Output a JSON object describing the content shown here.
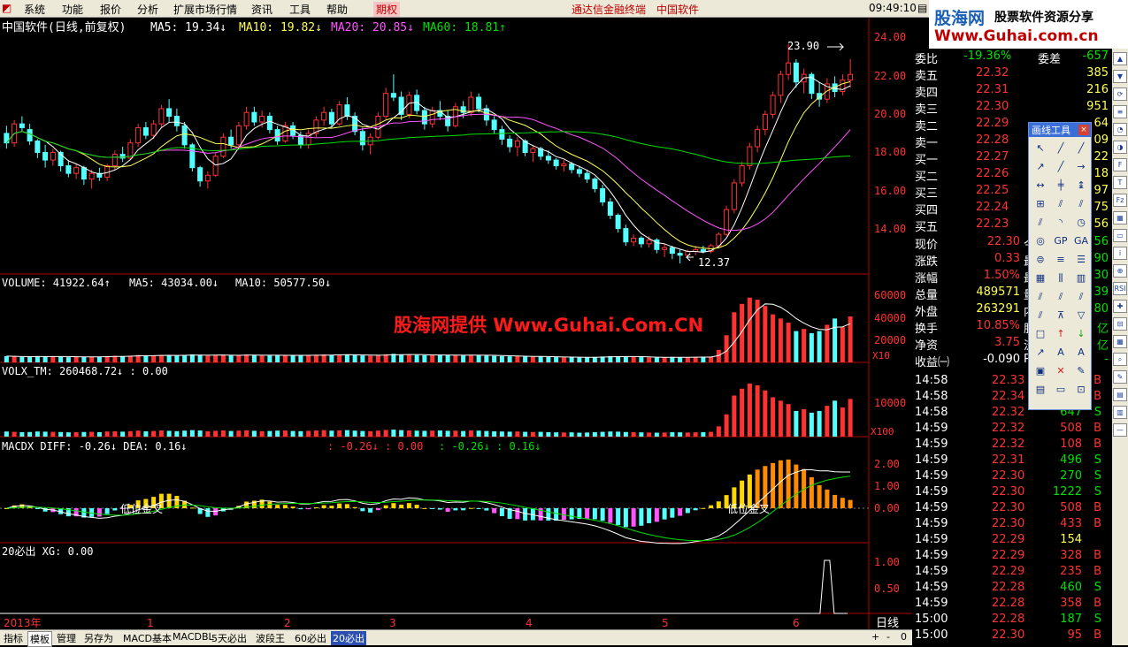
{
  "menu": {
    "items": [
      "系统",
      "功能",
      "报价",
      "分析",
      "扩展市场行情",
      "资讯",
      "工具",
      "帮助"
    ],
    "futures_tab": "期权",
    "ticker_text": "通达信金融终端",
    "stock_name": "中国软件",
    "clock": "09:49:10"
  },
  "logo": {
    "brand": "股海网",
    "tagline": "股票软件资源分享",
    "url": "Www.Guhai.com.cn"
  },
  "watermark": "股海网提供 Www.Guhai.Com.CN",
  "price_panel": {
    "title": "中国软件(日线,前复权)",
    "ma5": "MA5: 19.34↓",
    "ma10": "MA10: 19.82↓",
    "ma20": "MA20: 20.85↓",
    "ma60": "MA60: 18.81↑",
    "high_label": "23.90",
    "low_label": "12.37",
    "axis": [
      "24.00",
      "22.00",
      "20.00",
      "18.00",
      "16.00",
      "14.00"
    ]
  },
  "volume_panel": {
    "title": "VOLUME: 41922.64↑",
    "ma5": "MA5: 43034.00↓",
    "ma10": "MA10: 50577.50↓",
    "axis": [
      "60000",
      "40000",
      "20000"
    ],
    "unit": "X10"
  },
  "volx_panel": {
    "title": "VOLX_TM: 260468.72↓ : 0.00",
    "axis": [
      "10000"
    ],
    "unit": "X100"
  },
  "macd_panel": {
    "title": "MACDX DIFF: -0.26↓ DEA: 0.16↓",
    "extra1": ": -0.26↓ : 0.00",
    "extra2": ": -0.26↓ : 0.16↓",
    "golden_cross": "低位金叉",
    "axis": [
      "2.00",
      "1.00",
      "0.00"
    ]
  },
  "signal_panel": {
    "title": "20必出 XG: 0.00",
    "axis": [
      "1.00",
      "0.50"
    ]
  },
  "time_axis": [
    "2013年",
    "1",
    "2",
    "3",
    "4",
    "5",
    "6"
  ],
  "period_label": "日线",
  "quote": {
    "weibi": {
      "label": "委比",
      "value": "-19.36%",
      "label2": "委差",
      "value2": "-657"
    },
    "asks": [
      {
        "label": "卖五",
        "price": "22.32",
        "vol": "385"
      },
      {
        "label": "卖四",
        "price": "22.31",
        "vol": "216"
      },
      {
        "label": "卖三",
        "price": "22.30",
        "vol": "951"
      },
      {
        "label": "卖二",
        "price": "22.29",
        "vol": "64"
      },
      {
        "label": "卖一",
        "price": "22.28",
        "vol": "09"
      }
    ],
    "bids": [
      {
        "label": "买一",
        "price": "22.27",
        "vol": "22"
      },
      {
        "label": "买二",
        "price": "22.26",
        "vol": "18"
      },
      {
        "label": "买三",
        "price": "22.25",
        "vol": "97"
      },
      {
        "label": "买四",
        "price": "22.24",
        "vol": "75"
      },
      {
        "label": "买五",
        "price": "22.23",
        "vol": "56"
      }
    ],
    "stats": [
      {
        "label": "现价",
        "value": "22.30",
        "label2": "今",
        "value2": "56"
      },
      {
        "label": "涨跌",
        "value": "0.33",
        "label2": "最",
        "value2": "90"
      },
      {
        "label": "涨幅",
        "value": "1.50%",
        "label2": "最",
        "value2": "30"
      },
      {
        "label": "总量",
        "value": "489571",
        "label2": "量",
        "value2": "39"
      },
      {
        "label": "外盘",
        "value": "263291",
        "label2": "内",
        "value2": "80"
      },
      {
        "label": "换手",
        "value": "10.85%",
        "label2": "股",
        "value2": "亿"
      },
      {
        "label": "净资",
        "value": "3.75",
        "label2": "流",
        "value2": "亿"
      },
      {
        "label": "收益㈠",
        "value": "-0.090",
        "label2": "PE",
        "value2": "-"
      }
    ],
    "ticks": [
      {
        "time": "14:58",
        "price": "22.33",
        "vol": "",
        "side": "B"
      },
      {
        "time": "14:58",
        "price": "22.34",
        "vol": "",
        "side": "B"
      },
      {
        "time": "14:58",
        "price": "22.32",
        "vol": "647",
        "side": "S"
      },
      {
        "time": "14:59",
        "price": "22.32",
        "vol": "508",
        "side": "B"
      },
      {
        "time": "14:59",
        "price": "22.32",
        "vol": "108",
        "side": "B"
      },
      {
        "time": "14:59",
        "price": "22.31",
        "vol": "496",
        "side": "S"
      },
      {
        "time": "14:59",
        "price": "22.30",
        "vol": "270",
        "side": "S"
      },
      {
        "time": "14:59",
        "price": "22.30",
        "vol": "1222",
        "side": "S"
      },
      {
        "time": "14:59",
        "price": "22.30",
        "vol": "508",
        "side": "B"
      },
      {
        "time": "14:59",
        "price": "22.30",
        "vol": "433",
        "side": "B"
      },
      {
        "time": "14:59",
        "price": "22.29",
        "vol": "154",
        "side": ""
      },
      {
        "time": "14:59",
        "price": "22.29",
        "vol": "328",
        "side": "B"
      },
      {
        "time": "14:59",
        "price": "22.29",
        "vol": "235",
        "side": "B"
      },
      {
        "time": "14:59",
        "price": "22.28",
        "vol": "460",
        "side": "S"
      },
      {
        "time": "14:59",
        "price": "22.28",
        "vol": "358",
        "side": "B"
      },
      {
        "time": "15:00",
        "price": "22.28",
        "vol": "187",
        "side": "S"
      },
      {
        "time": "15:00",
        "price": "22.30",
        "vol": "95",
        "side": "B"
      }
    ]
  },
  "drawing_tools": {
    "title": "画线工具",
    "close": "×"
  },
  "bottom_tabs": [
    "指标",
    "模板",
    "管理",
    "另存为",
    "MACD基本",
    "MACDBL",
    "5天必出",
    "波段王",
    "60必出",
    "20必出"
  ],
  "bottom_right": [
    "+",
    "-",
    "0"
  ],
  "colors": {
    "up": "#ff3232",
    "down": "#54ffff",
    "ma5": "#ffffff",
    "ma10": "#ffff54",
    "ma20": "#ff54ff",
    "ma60": "#00e000",
    "grid": "#b00000"
  },
  "chart_data": {
    "type": "candlestick",
    "candles": [
      [
        19.2,
        19.6,
        18.4,
        18.7
      ],
      [
        18.7,
        19.9,
        18.5,
        19.7
      ],
      [
        19.7,
        20.1,
        19.3,
        19.5
      ],
      [
        19.4,
        19.7,
        18.6,
        18.8
      ],
      [
        18.8,
        18.9,
        17.9,
        18.2
      ],
      [
        18.2,
        18.6,
        17.4,
        17.8
      ],
      [
        17.8,
        18.4,
        17.5,
        18.2
      ],
      [
        18.2,
        18.3,
        17.2,
        17.5
      ],
      [
        17.5,
        17.8,
        16.9,
        17.1
      ],
      [
        17.1,
        17.6,
        16.8,
        17.4
      ],
      [
        17.4,
        17.5,
        16.5,
        16.8
      ],
      [
        16.8,
        17.3,
        16.3,
        17.1
      ],
      [
        17.1,
        17.4,
        16.7,
        16.9
      ],
      [
        16.9,
        17.6,
        16.7,
        17.5
      ],
      [
        17.5,
        18.3,
        17.3,
        18.1
      ],
      [
        18.1,
        18.5,
        17.7,
        17.9
      ],
      [
        17.9,
        18.9,
        17.8,
        18.7
      ],
      [
        18.7,
        19.7,
        18.5,
        19.5
      ],
      [
        19.5,
        19.8,
        18.9,
        19.1
      ],
      [
        19.1,
        19.9,
        18.9,
        19.7
      ],
      [
        19.7,
        20.7,
        19.5,
        20.5
      ],
      [
        20.5,
        21.0,
        19.8,
        20.1
      ],
      [
        20.1,
        20.5,
        19.3,
        19.6
      ],
      [
        19.6,
        19.8,
        18.4,
        18.6
      ],
      [
        18.6,
        18.7,
        17.2,
        17.4
      ],
      [
        17.4,
        17.5,
        16.4,
        16.7
      ],
      [
        16.7,
        17.2,
        16.3,
        17.0
      ],
      [
        17.0,
        18.2,
        16.9,
        18.0
      ],
      [
        18.0,
        19.2,
        17.9,
        19.0
      ],
      [
        19.0,
        19.4,
        18.4,
        18.6
      ],
      [
        18.6,
        19.8,
        18.5,
        19.6
      ],
      [
        19.6,
        20.6,
        19.4,
        20.3
      ],
      [
        20.3,
        20.6,
        19.6,
        19.8
      ],
      [
        19.8,
        20.4,
        19.5,
        20.1
      ],
      [
        20.1,
        20.3,
        19.2,
        19.4
      ],
      [
        19.4,
        19.6,
        18.6,
        18.8
      ],
      [
        18.8,
        19.8,
        18.7,
        19.6
      ],
      [
        19.6,
        19.8,
        18.9,
        19.1
      ],
      [
        19.1,
        19.3,
        18.4,
        18.6
      ],
      [
        18.6,
        19.4,
        18.4,
        19.2
      ],
      [
        19.2,
        20.1,
        19.0,
        19.9
      ],
      [
        19.9,
        20.6,
        19.6,
        20.3
      ],
      [
        20.3,
        20.5,
        19.5,
        19.7
      ],
      [
        19.7,
        20.9,
        19.6,
        20.7
      ],
      [
        20.7,
        21.1,
        19.9,
        20.1
      ],
      [
        20.1,
        20.3,
        19.1,
        19.3
      ],
      [
        19.3,
        19.5,
        18.3,
        18.6
      ],
      [
        18.6,
        19.2,
        18.1,
        19.0
      ],
      [
        19.0,
        20.3,
        18.9,
        20.1
      ],
      [
        20.1,
        21.6,
        19.9,
        21.3
      ],
      [
        21.3,
        22.3,
        20.9,
        21.1
      ],
      [
        21.1,
        21.4,
        19.9,
        20.2
      ],
      [
        20.2,
        21.4,
        20.0,
        21.2
      ],
      [
        21.2,
        21.5,
        20.2,
        20.4
      ],
      [
        20.4,
        20.6,
        19.4,
        19.7
      ],
      [
        19.7,
        20.6,
        19.5,
        20.4
      ],
      [
        20.4,
        20.9,
        19.9,
        20.1
      ],
      [
        20.1,
        20.4,
        19.3,
        19.6
      ],
      [
        19.6,
        20.8,
        19.5,
        20.6
      ],
      [
        20.6,
        20.9,
        20.0,
        20.3
      ],
      [
        20.3,
        21.4,
        20.1,
        21.1
      ],
      [
        21.1,
        21.3,
        20.3,
        20.5
      ],
      [
        20.5,
        20.7,
        19.6,
        19.9
      ],
      [
        19.9,
        20.1,
        19.2,
        19.4
      ],
      [
        19.4,
        19.6,
        18.6,
        18.9
      ],
      [
        18.9,
        19.1,
        18.2,
        18.5
      ],
      [
        18.5,
        19.0,
        18.0,
        18.8
      ],
      [
        18.8,
        18.9,
        18.0,
        18.2
      ],
      [
        18.2,
        18.6,
        17.7,
        18.4
      ],
      [
        18.4,
        18.5,
        17.8,
        18.0
      ],
      [
        18.0,
        18.3,
        17.6,
        17.8
      ],
      [
        17.8,
        17.9,
        17.3,
        17.5
      ],
      [
        17.5,
        17.8,
        17.2,
        17.6
      ],
      [
        17.6,
        17.7,
        17.1,
        17.3
      ],
      [
        17.3,
        17.5,
        16.9,
        17.1
      ],
      [
        17.1,
        17.3,
        16.6,
        16.8
      ],
      [
        16.8,
        16.9,
        16.1,
        16.3
      ],
      [
        16.3,
        16.5,
        15.4,
        15.6
      ],
      [
        15.6,
        15.8,
        14.7,
        14.9
      ],
      [
        14.9,
        15.0,
        14.0,
        14.2
      ],
      [
        14.2,
        14.4,
        13.3,
        13.5
      ],
      [
        13.5,
        13.9,
        13.3,
        13.7
      ],
      [
        13.7,
        13.8,
        13.2,
        13.4
      ],
      [
        13.4,
        13.8,
        13.2,
        13.6
      ],
      [
        13.6,
        13.7,
        12.9,
        13.1
      ],
      [
        13.1,
        13.4,
        12.7,
        13.2
      ],
      [
        13.2,
        13.3,
        12.6,
        12.9
      ],
      [
        12.9,
        13.1,
        12.37,
        12.8
      ],
      [
        12.8,
        13.1,
        12.7,
        13.0
      ],
      [
        13.0,
        13.3,
        12.8,
        13.1
      ],
      [
        13.1,
        13.3,
        12.9,
        13.0
      ],
      [
        13.0,
        13.4,
        12.9,
        13.3
      ],
      [
        13.3,
        14.0,
        13.2,
        13.9
      ],
      [
        13.9,
        15.4,
        13.8,
        15.2
      ],
      [
        15.2,
        16.8,
        15.0,
        16.6
      ],
      [
        16.6,
        17.7,
        16.4,
        17.5
      ],
      [
        17.5,
        18.7,
        17.3,
        18.5
      ],
      [
        18.5,
        19.6,
        18.2,
        19.4
      ],
      [
        19.4,
        20.4,
        19.1,
        20.2
      ],
      [
        20.2,
        21.4,
        20.0,
        21.2
      ],
      [
        21.2,
        22.5,
        20.8,
        22.3
      ],
      [
        22.3,
        23.9,
        22.0,
        22.9
      ],
      [
        22.9,
        23.1,
        21.6,
        21.9
      ],
      [
        21.9,
        22.6,
        21.3,
        22.3
      ],
      [
        22.3,
        22.4,
        21.0,
        21.3
      ],
      [
        21.3,
        21.9,
        20.6,
        21.0
      ],
      [
        21.0,
        22.1,
        20.8,
        21.8
      ],
      [
        21.8,
        22.2,
        21.1,
        21.4
      ],
      [
        21.4,
        22.3,
        21.2,
        22.0
      ],
      [
        22.0,
        23.1,
        21.6,
        22.3
      ]
    ],
    "volumes": [
      600,
      560,
      520,
      540,
      600,
      580,
      560,
      540,
      500,
      520,
      540,
      560,
      520,
      600,
      620,
      580,
      640,
      700,
      620,
      660,
      720,
      680,
      640,
      700,
      760,
      720,
      640,
      680,
      720,
      660,
      700,
      740,
      680,
      640,
      660,
      700,
      720,
      660,
      640,
      680,
      720,
      760,
      700,
      740,
      760,
      700,
      660,
      640,
      700,
      780,
      820,
      760,
      720,
      700,
      680,
      700,
      720,
      680,
      700,
      660,
      720,
      700,
      660,
      620,
      600,
      580,
      600,
      560,
      540,
      560,
      520,
      500,
      480,
      500,
      460,
      480,
      520,
      560,
      600,
      580,
      540,
      520,
      500,
      480,
      460,
      480,
      520,
      500,
      480,
      500,
      520,
      560,
      1200,
      2600,
      4800,
      5600,
      6200,
      6000,
      5400,
      4600,
      4200,
      3800,
      3000,
      3200,
      2800,
      3000,
      3600,
      4200,
      3400,
      4400
    ],
    "ylim_price": [
      12,
      25
    ],
    "ylim_volume": [
      0,
      66000
    ],
    "signal_bar": 106
  }
}
